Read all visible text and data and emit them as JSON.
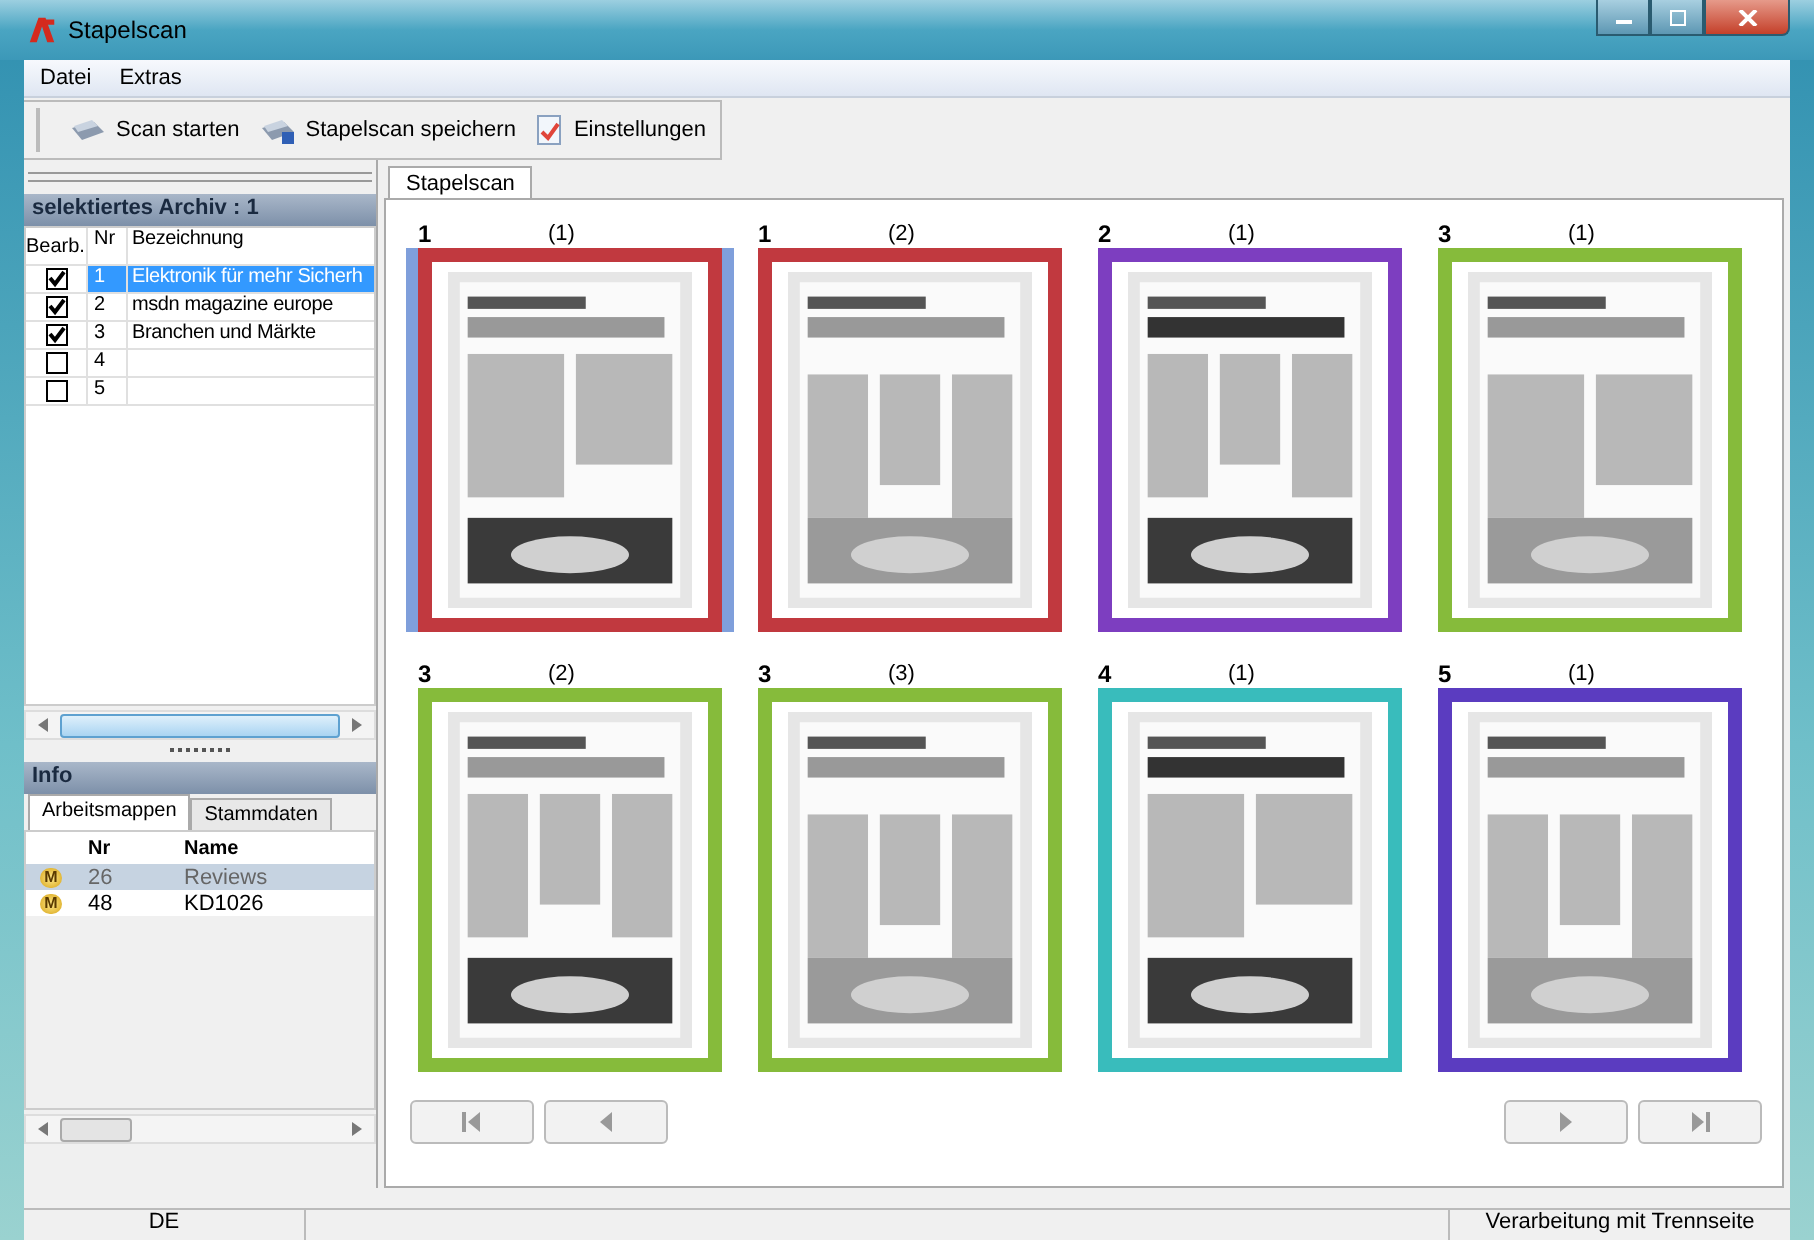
{
  "window": {
    "title": "Stapelscan"
  },
  "menu": [
    "Datei",
    "Extras"
  ],
  "toolbar": [
    {
      "label": "Scan starten",
      "kind": "scan"
    },
    {
      "label": "Stapelscan speichern",
      "kind": "save"
    },
    {
      "label": "Einstellungen",
      "kind": "settings"
    }
  ],
  "archive": {
    "title": "selektiertes Archiv : 1",
    "columns": [
      "Bearb.",
      "Nr",
      "Bezeichnung"
    ],
    "rows": [
      {
        "checked": true,
        "nr": "1",
        "name": "Elektronik für mehr Sicherh",
        "selected": true
      },
      {
        "checked": true,
        "nr": "2",
        "name": "msdn magazine europe",
        "selected": false
      },
      {
        "checked": true,
        "nr": "3",
        "name": "Branchen und Märkte",
        "selected": false
      },
      {
        "checked": false,
        "nr": "4",
        "selected": false
      },
      {
        "checked": false,
        "nr": "5",
        "selected": false
      }
    ]
  },
  "info": {
    "title": "Info",
    "tabs": [
      {
        "label": "Arbeitsmappen",
        "selected": true
      },
      {
        "label": "Stammdaten",
        "selected": false
      }
    ],
    "columns": [
      "Nr",
      "Name"
    ],
    "rows": [
      {
        "badge": "M",
        "nr": "26",
        "name": "Reviews",
        "selected": true
      },
      {
        "badge": "M",
        "nr": "48",
        "name": "KD1026",
        "selected": false
      }
    ]
  },
  "content_tabs": [
    {
      "label": "Stapelscan",
      "selected": true
    }
  ],
  "pages": [
    {
      "doc": "1",
      "page": "(1)",
      "color": "#c1393f",
      "selected": true
    },
    {
      "doc": "1",
      "page": "(2)",
      "color": "#c1393f",
      "selected": false
    },
    {
      "doc": "2",
      "page": "(1)",
      "color": "#7d3ec0",
      "selected": false
    },
    {
      "doc": "3",
      "page": "(1)",
      "color": "#86bb3b",
      "selected": false
    },
    {
      "doc": "3",
      "page": "(2)",
      "color": "#86bb3b",
      "selected": false
    },
    {
      "doc": "3",
      "page": "(3)",
      "color": "#86bb3b",
      "selected": false
    },
    {
      "doc": "4",
      "page": "(1)",
      "color": "#39bcbc",
      "selected": false
    },
    {
      "doc": "5",
      "page": "(1)",
      "color": "#5b3cc0",
      "selected": false
    }
  ],
  "status_bar": [
    "DE",
    "Verarbeitung mit Trennseite"
  ]
}
